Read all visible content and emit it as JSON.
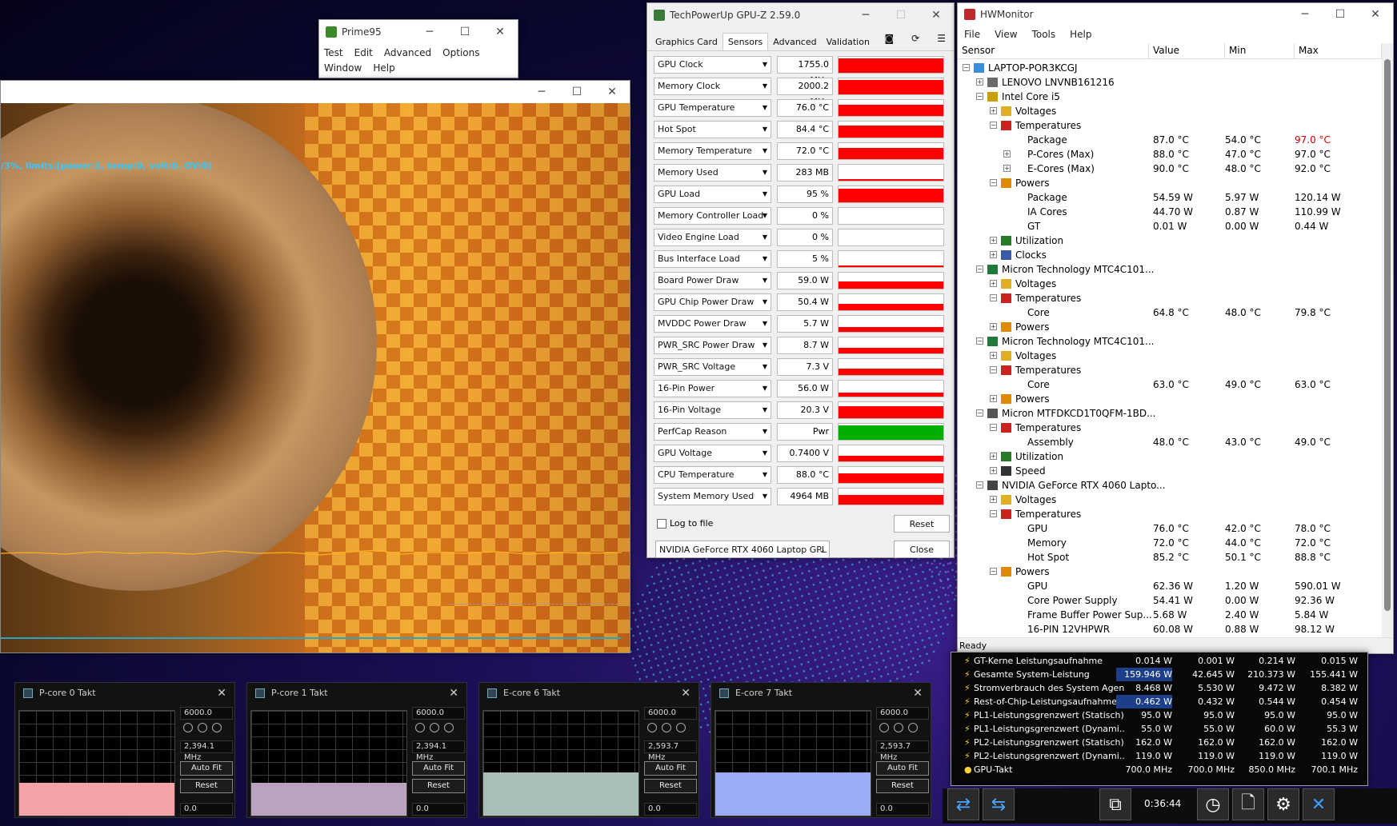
{
  "prime95": {
    "title": "Prime95",
    "menu": [
      "Test",
      "Edit",
      "Advanced",
      "Options",
      "Window",
      "Help"
    ]
  },
  "render": {
    "osd_text": "/3%, limits:[power:1, temp:0, volt:0, OV:0]"
  },
  "gpuz": {
    "title": "TechPowerUp GPU-Z 2.59.0",
    "tabs": [
      "Graphics Card",
      "Sensors",
      "Advanced",
      "Validation"
    ],
    "active_tab": "Sensors",
    "sensors": [
      {
        "name": "GPU Clock",
        "value": "1755.0 MHz",
        "level": 0.9,
        "color": "#ff0000"
      },
      {
        "name": "Memory Clock",
        "value": "2000.2 MHz",
        "level": 0.9,
        "color": "#ff0000"
      },
      {
        "name": "GPU Temperature",
        "value": "76.0 °C",
        "level": 0.7,
        "color": "#ff0000"
      },
      {
        "name": "Hot Spot",
        "value": "84.4 °C",
        "level": 0.75,
        "color": "#ff0000"
      },
      {
        "name": "Memory Temperature",
        "value": "72.0 °C",
        "level": 0.7,
        "color": "#ff0000"
      },
      {
        "name": "Memory Used",
        "value": "283 MB",
        "level": 0.04,
        "color": "#ff0000"
      },
      {
        "name": "GPU Load",
        "value": "95 %",
        "level": 0.85,
        "color": "#ff0000"
      },
      {
        "name": "Memory Controller Load",
        "value": "0 %",
        "level": 0.0,
        "color": "#ff0000"
      },
      {
        "name": "Video Engine Load",
        "value": "0 %",
        "level": 0.0,
        "color": "#ff0000"
      },
      {
        "name": "Bus Interface Load",
        "value": "5 %",
        "level": 0.05,
        "color": "#ff0000"
      },
      {
        "name": "Board Power Draw",
        "value": "59.0 W",
        "level": 0.45,
        "color": "#ff0000"
      },
      {
        "name": "GPU Chip Power Draw",
        "value": "50.4 W",
        "level": 0.4,
        "color": "#ff0000"
      },
      {
        "name": "MVDDC Power Draw",
        "value": "5.7 W",
        "level": 0.3,
        "color": "#ff0000"
      },
      {
        "name": "PWR_SRC Power Draw",
        "value": "8.7 W",
        "level": 0.35,
        "color": "#ff0000"
      },
      {
        "name": "PWR_SRC Voltage",
        "value": "7.3 V",
        "level": 0.4,
        "color": "#ff0000"
      },
      {
        "name": "16-Pin Power",
        "value": "56.0 W",
        "level": 0.25,
        "color": "#ff0000"
      },
      {
        "name": "16-Pin Voltage",
        "value": "20.3 V",
        "level": 0.75,
        "color": "#ff0000"
      },
      {
        "name": "PerfCap Reason",
        "value": "Pwr",
        "level": 0.9,
        "color": "#00b000"
      },
      {
        "name": "GPU Voltage",
        "value": "0.7400 V",
        "level": 0.35,
        "color": "#ff0000"
      },
      {
        "name": "CPU Temperature",
        "value": "88.0 °C",
        "level": 0.6,
        "color": "#ff0000"
      },
      {
        "name": "System Memory Used",
        "value": "4964 MB",
        "level": 0.6,
        "color": "#ff0000"
      }
    ],
    "log_label": "Log to file",
    "reset_label": "Reset",
    "device": "NVIDIA GeForce RTX 4060 Laptop GPL",
    "close_label": "Close"
  },
  "hwm": {
    "title": "HWMonitor",
    "menu": [
      "File",
      "View",
      "Tools",
      "Help"
    ],
    "headers": [
      "Sensor",
      "Value",
      "Min",
      "Max"
    ],
    "status": "Ready",
    "rows": [
      {
        "d": 0,
        "e": "−",
        "ic": "pc",
        "t": "LAPTOP-POR3KCGJ"
      },
      {
        "d": 1,
        "e": "+",
        "ic": "board",
        "t": "LENOVO LNVNB161216"
      },
      {
        "d": 1,
        "e": "−",
        "ic": "cpu",
        "t": "Intel Core i5"
      },
      {
        "d": 2,
        "e": "+",
        "ic": "volt",
        "t": "Voltages"
      },
      {
        "d": 2,
        "e": "−",
        "ic": "temp",
        "t": "Temperatures"
      },
      {
        "d": 3,
        "e": "",
        "t": "Package",
        "v": "87.0 °C",
        "mn": "54.0 °C",
        "mx": "97.0 °C",
        "hot": true
      },
      {
        "d": 3,
        "e": "+",
        "t": "P-Cores (Max)",
        "v": "88.0 °C",
        "mn": "47.0 °C",
        "mx": "97.0 °C"
      },
      {
        "d": 3,
        "e": "+",
        "t": "E-Cores (Max)",
        "v": "90.0 °C",
        "mn": "48.0 °C",
        "mx": "92.0 °C"
      },
      {
        "d": 2,
        "e": "−",
        "ic": "power",
        "t": "Powers"
      },
      {
        "d": 3,
        "e": "",
        "t": "Package",
        "v": "54.59 W",
        "mn": "5.97 W",
        "mx": "120.14 W"
      },
      {
        "d": 3,
        "e": "",
        "t": "IA Cores",
        "v": "44.70 W",
        "mn": "0.87 W",
        "mx": "110.99 W"
      },
      {
        "d": 3,
        "e": "",
        "t": "GT",
        "v": "0.01 W",
        "mn": "0.00 W",
        "mx": "0.44 W"
      },
      {
        "d": 2,
        "e": "+",
        "ic": "util",
        "t": "Utilization"
      },
      {
        "d": 2,
        "e": "+",
        "ic": "clock",
        "t": "Clocks"
      },
      {
        "d": 1,
        "e": "−",
        "ic": "ram",
        "t": "Micron Technology MTC4C101..."
      },
      {
        "d": 2,
        "e": "+",
        "ic": "volt",
        "t": "Voltages"
      },
      {
        "d": 2,
        "e": "−",
        "ic": "temp",
        "t": "Temperatures"
      },
      {
        "d": 3,
        "e": "",
        "t": "Core",
        "v": "64.8 °C",
        "mn": "48.0 °C",
        "mx": "79.8 °C"
      },
      {
        "d": 2,
        "e": "+",
        "ic": "power",
        "t": "Powers"
      },
      {
        "d": 1,
        "e": "−",
        "ic": "ram",
        "t": "Micron Technology MTC4C101..."
      },
      {
        "d": 2,
        "e": "+",
        "ic": "volt",
        "t": "Voltages"
      },
      {
        "d": 2,
        "e": "−",
        "ic": "temp",
        "t": "Temperatures"
      },
      {
        "d": 3,
        "e": "",
        "t": "Core",
        "v": "63.0 °C",
        "mn": "49.0 °C",
        "mx": "63.0 °C"
      },
      {
        "d": 2,
        "e": "+",
        "ic": "power",
        "t": "Powers"
      },
      {
        "d": 1,
        "e": "−",
        "ic": "ssd",
        "t": "Micron MTFDKCD1T0QFM-1BD..."
      },
      {
        "d": 2,
        "e": "−",
        "ic": "temp",
        "t": "Temperatures"
      },
      {
        "d": 3,
        "e": "",
        "t": "Assembly",
        "v": "48.0 °C",
        "mn": "43.0 °C",
        "mx": "49.0 °C"
      },
      {
        "d": 2,
        "e": "+",
        "ic": "util",
        "t": "Utilization"
      },
      {
        "d": 2,
        "e": "+",
        "ic": "speed",
        "t": "Speed"
      },
      {
        "d": 1,
        "e": "−",
        "ic": "gpu",
        "t": "NVIDIA GeForce RTX 4060 Lapto..."
      },
      {
        "d": 2,
        "e": "+",
        "ic": "volt",
        "t": "Voltages"
      },
      {
        "d": 2,
        "e": "−",
        "ic": "temp",
        "t": "Temperatures"
      },
      {
        "d": 3,
        "e": "",
        "t": "GPU",
        "v": "76.0 °C",
        "mn": "42.0 °C",
        "mx": "78.0 °C"
      },
      {
        "d": 3,
        "e": "",
        "t": "Memory",
        "v": "72.0 °C",
        "mn": "44.0 °C",
        "mx": "72.0 °C"
      },
      {
        "d": 3,
        "e": "",
        "t": "Hot Spot",
        "v": "85.2 °C",
        "mn": "50.1 °C",
        "mx": "88.8 °C"
      },
      {
        "d": 2,
        "e": "−",
        "ic": "power",
        "t": "Powers"
      },
      {
        "d": 3,
        "e": "",
        "t": "GPU",
        "v": "62.36 W",
        "mn": "1.20 W",
        "mx": "590.01 W"
      },
      {
        "d": 3,
        "e": "",
        "t": "Core Power Supply",
        "v": "54.41 W",
        "mn": "0.00 W",
        "mx": "92.36 W"
      },
      {
        "d": 3,
        "e": "",
        "t": "Frame Buffer Power Sup...",
        "v": "5.68 W",
        "mn": "2.40 W",
        "mx": "5.84 W"
      },
      {
        "d": 3,
        "e": "",
        "t": "16-PIN 12VHPWR",
        "v": "60.08 W",
        "mn": "0.88 W",
        "mx": "98.12 W"
      }
    ]
  },
  "dark": {
    "rows": [
      {
        "t": "GT-Kerne Leistungsaufnahme",
        "a": "0.014 W",
        "b": "0.001 W",
        "c": "0.214 W",
        "d": "0.015 W"
      },
      {
        "t": "Gesamte System-Leistung",
        "a": "159.946 W",
        "b": "42.645 W",
        "c": "210.373 W",
        "d": "155.441 W",
        "hl": true
      },
      {
        "t": "Stromverbrauch des System Agent",
        "a": "8.468 W",
        "b": "5.530 W",
        "c": "9.472 W",
        "d": "8.382 W"
      },
      {
        "t": "Rest-of-Chip-Leistungsaufnahme",
        "a": "0.462 W",
        "b": "0.432 W",
        "c": "0.544 W",
        "d": "0.454 W",
        "hl": true
      },
      {
        "t": "PL1-Leistungsgrenzwert (Statisch)",
        "a": "95.0 W",
        "b": "95.0 W",
        "c": "95.0 W",
        "d": "95.0 W"
      },
      {
        "t": "PL1-Leistungsgrenzwert (Dynami...",
        "a": "55.0 W",
        "b": "55.0 W",
        "c": "60.0 W",
        "d": "55.3 W"
      },
      {
        "t": "PL2-Leistungsgrenzwert (Statisch)",
        "a": "162.0 W",
        "b": "162.0 W",
        "c": "162.0 W",
        "d": "162.0 W"
      },
      {
        "t": "PL2-Leistungsgrenzwert (Dynami...",
        "a": "119.0 W",
        "b": "119.0 W",
        "c": "119.0 W",
        "d": "119.0 W"
      },
      {
        "t": "GPU-Takt",
        "a": "700.0 MHz",
        "b": "700.0 MHz",
        "c": "850.0 MHz",
        "d": "700.1 MHz"
      }
    ],
    "time": "0:36:44"
  },
  "minis": [
    {
      "title": "P-core 0 Takt",
      "max": "6000.0",
      "cur": "2,394.1 MHz",
      "min": "0.0",
      "color": "#f4a3a8",
      "level": 0.31
    },
    {
      "title": "P-core 1 Takt",
      "max": "6000.0",
      "cur": "2,394.1 MHz",
      "min": "0.0",
      "color": "#b9a3be",
      "level": 0.31
    },
    {
      "title": "E-core 6 Takt",
      "max": "6000.0",
      "cur": "2,593.7 MHz",
      "min": "0.0",
      "color": "#a9beb5",
      "level": 0.41
    },
    {
      "title": "E-core 7 Takt",
      "max": "6000.0",
      "cur": "2,593.7 MHz",
      "min": "0.0",
      "color": "#99acf5",
      "level": 0.41
    }
  ],
  "mini_labels": {
    "autofit": "Auto Fit",
    "reset": "Reset"
  }
}
